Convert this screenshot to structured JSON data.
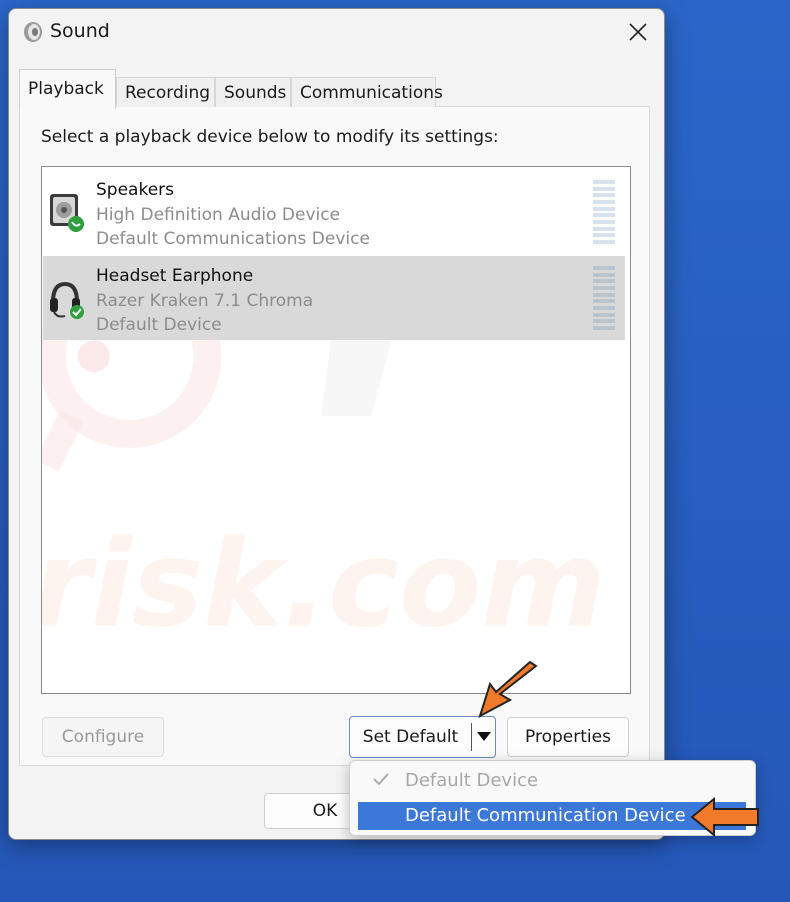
{
  "window": {
    "title": "Sound",
    "icon": "speaker-icon",
    "close_icon": "close-icon"
  },
  "tabs": [
    {
      "label": "Playback",
      "active": true
    },
    {
      "label": "Recording",
      "active": false
    },
    {
      "label": "Sounds",
      "active": false
    },
    {
      "label": "Communications",
      "active": false
    }
  ],
  "instruction": "Select a playback device below to modify its settings:",
  "devices": [
    {
      "name": "Speakers",
      "description": "High Definition Audio Device",
      "status": "Default Communications Device",
      "icon": "speakers-icon",
      "badge": "green-phone-badge",
      "selected": false
    },
    {
      "name": "Headset Earphone",
      "description": "Razer Kraken 7.1 Chroma",
      "status": "Default Device",
      "icon": "headset-icon",
      "badge": "green-check-badge",
      "selected": true
    }
  ],
  "buttons": {
    "configure": "Configure",
    "set_default": "Set Default",
    "properties": "Properties",
    "ok": "OK"
  },
  "dropdown": {
    "items": [
      {
        "label": "Default Device",
        "checked": true,
        "enabled": false
      },
      {
        "label": "Default Communication Device",
        "checked": false,
        "enabled": true,
        "highlighted": true
      }
    ]
  },
  "colors": {
    "accent": "#3b78d8",
    "annotation_arrow": "#f07a2a",
    "desktop": "#2a66c9",
    "badge_green": "#2e9e3e"
  }
}
